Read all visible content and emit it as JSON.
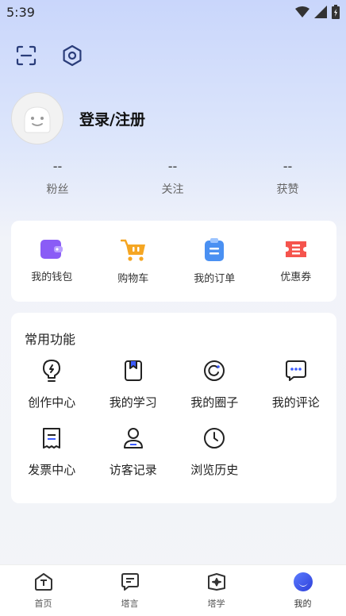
{
  "status": {
    "time": "5:39"
  },
  "profile": {
    "login_label": "登录/注册"
  },
  "stats": [
    {
      "value": "--",
      "label": "粉丝"
    },
    {
      "value": "--",
      "label": "关注"
    },
    {
      "value": "--",
      "label": "获赞"
    }
  ],
  "wallet": [
    {
      "label": "我的钱包",
      "icon": "wallet-icon"
    },
    {
      "label": "购物车",
      "icon": "cart-icon"
    },
    {
      "label": "我的订单",
      "icon": "order-icon"
    },
    {
      "label": "优惠券",
      "icon": "coupon-icon"
    }
  ],
  "common": {
    "title": "常用功能",
    "items": [
      {
        "label": "创作中心",
        "icon": "bulb-icon"
      },
      {
        "label": "我的学习",
        "icon": "book-icon"
      },
      {
        "label": "我的圈子",
        "icon": "circle-icon"
      },
      {
        "label": "我的评论",
        "icon": "comment-icon"
      },
      {
        "label": "发票中心",
        "icon": "invoice-icon"
      },
      {
        "label": "访客记录",
        "icon": "person-icon"
      },
      {
        "label": "浏览历史",
        "icon": "clock-icon"
      }
    ]
  },
  "tabs": [
    {
      "label": "首页",
      "icon": "home-icon"
    },
    {
      "label": "塔言",
      "icon": "message-icon"
    },
    {
      "label": "塔学",
      "icon": "learn-icon"
    },
    {
      "label": "我的",
      "icon": "profile-icon",
      "active": true
    }
  ],
  "colors": {
    "wallet": "#8a5cf6",
    "cart": "#f5a623",
    "order": "#4a90f2",
    "coupon": "#f5544d",
    "accent": "#3b5bff"
  }
}
